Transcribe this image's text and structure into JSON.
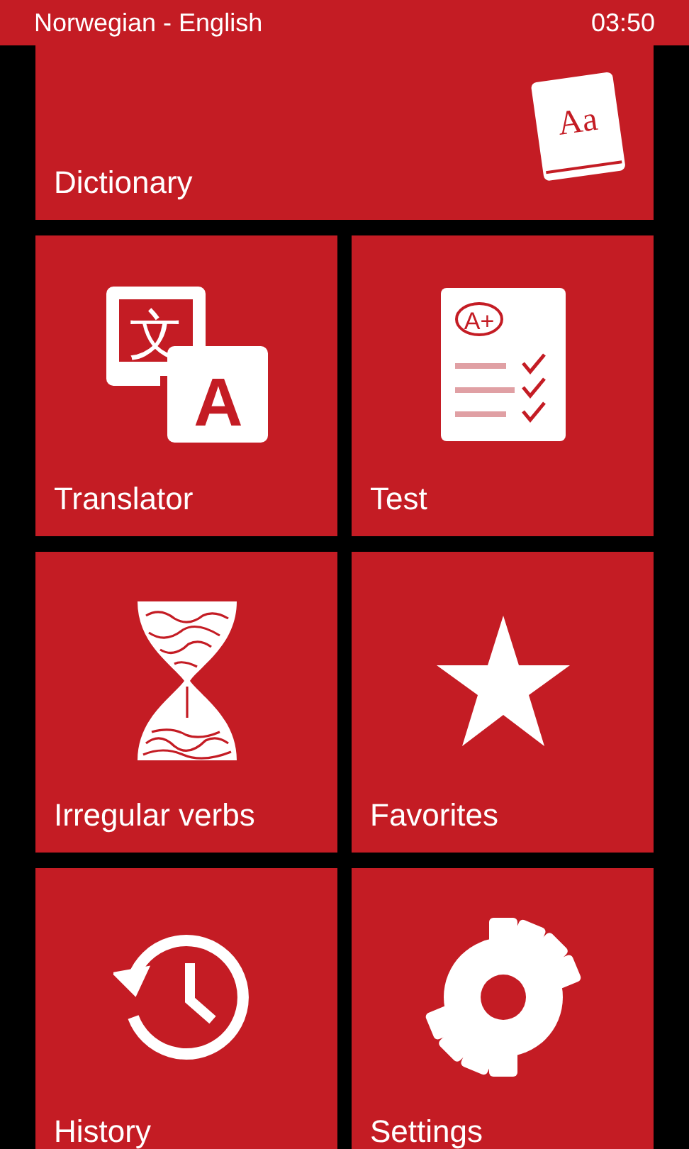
{
  "status_bar": {
    "title": "Norwegian - English",
    "time": "03:50"
  },
  "tiles": [
    {
      "label": "Dictionary",
      "kind": "dictionary",
      "glyphs": [
        "Aa"
      ]
    },
    {
      "label": "Translator",
      "kind": "translator",
      "glyphs": [
        "文",
        "A"
      ]
    },
    {
      "label": "Test",
      "kind": "test",
      "glyphs": [
        "A+"
      ]
    },
    {
      "label": "Irregular verbs",
      "kind": "verbs"
    },
    {
      "label": "Favorites",
      "kind": "favorites"
    },
    {
      "label": "History",
      "kind": "history"
    },
    {
      "label": "Settings",
      "kind": "settings"
    }
  ]
}
